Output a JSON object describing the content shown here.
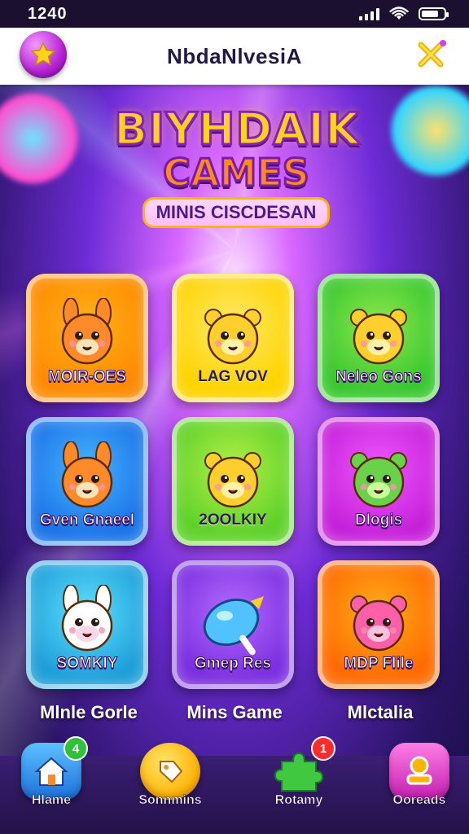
{
  "status_bar": {
    "time": "1240"
  },
  "header": {
    "title": "NbdaNlvesiA",
    "left_icon": "star-icon",
    "right_icon": "close-icon"
  },
  "logo": {
    "line1": "BIYHDAIK",
    "line2": "CAMES",
    "line3": "MINIS CISCDESAN"
  },
  "games": [
    {
      "label": "MOIR-OES",
      "colors": [
        "#ff8a00",
        "#ffb21a"
      ],
      "creature": "fox-icon"
    },
    {
      "label": "LAG VOV",
      "colors": [
        "#ffd400",
        "#ffe96b"
      ],
      "creature": "bear-icon"
    },
    {
      "label": "Neleo Gons",
      "colors": [
        "#39c72f",
        "#8ee84d"
      ],
      "creature": "bear-icon"
    },
    {
      "label": "Gven Gnaeel",
      "colors": [
        "#1a73e8",
        "#47b5ff"
      ],
      "creature": "fox-icon"
    },
    {
      "label": "2OOLKIY",
      "colors": [
        "#5fd12a",
        "#b4f046"
      ],
      "creature": "bear-icon"
    },
    {
      "label": "Dlogis",
      "colors": [
        "#c521d9",
        "#ef58ff"
      ],
      "creature": "frog-icon"
    },
    {
      "label": "SOMKIY",
      "colors": [
        "#1e9fd9",
        "#5ee0ff"
      ],
      "creature": "bunny-icon"
    },
    {
      "label": "Gmep Res",
      "colors": [
        "#7b2fe0",
        "#b56bff"
      ],
      "creature": "candy-icon"
    },
    {
      "label": "MDP Flile",
      "colors": [
        "#ff6a00",
        "#ffae1a"
      ],
      "creature": "monster-icon"
    }
  ],
  "captions": [
    "Mlnle Gorle",
    "Mins Game",
    "Mlctalia"
  ],
  "nav": [
    {
      "label": "Hlame",
      "icon": "home-icon",
      "badge": "4",
      "color": "#2e8ff5"
    },
    {
      "label": "Sonnmins",
      "icon": "tag-icon",
      "badge": "",
      "color": "#ffc400"
    },
    {
      "label": "Rotamy",
      "icon": "puzzle-icon",
      "badge": "1",
      "color": "#36c23a"
    },
    {
      "label": "Ooreads",
      "icon": "trophy-icon",
      "badge": "",
      "color": "#e23ac4"
    }
  ]
}
